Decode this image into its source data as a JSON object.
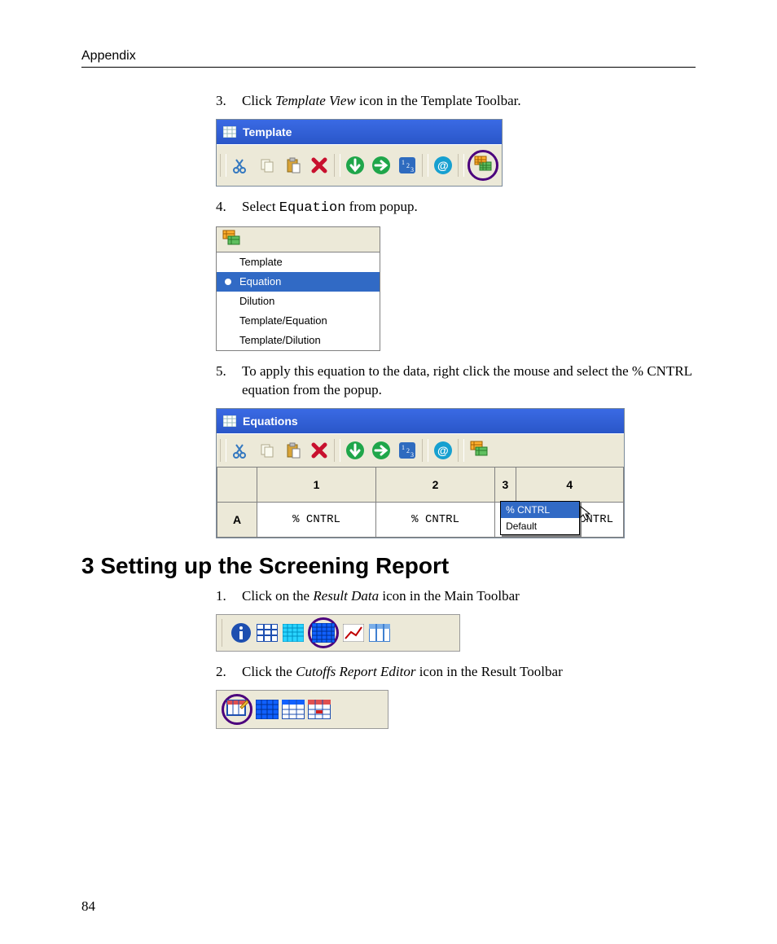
{
  "header": {
    "title": "Appendix"
  },
  "steps_a": {
    "s3": {
      "num": "3.",
      "pre": "Click ",
      "italic": "Template View",
      "post": " icon in the Template Toolbar."
    },
    "s4": {
      "num": "4.",
      "pre": "Select ",
      "mono": "Equation",
      "post": " from popup."
    },
    "s5": {
      "num": "5.",
      "text": "To apply this equation to the data, right click the mouse and select the % CNTRL equation from the popup."
    }
  },
  "template_window": {
    "title": "Template"
  },
  "popup": {
    "items": [
      "Template",
      "Equation",
      "Dilution",
      "Template/Equation",
      "Template/Dilution"
    ],
    "selected_index": 1
  },
  "equations_window": {
    "title": "Equations",
    "cols": [
      "1",
      "2",
      "3",
      "4"
    ],
    "row_label": "A",
    "cells": [
      "% CNTRL",
      "% CNTRL",
      "",
      "CNTRL"
    ],
    "context_menu": {
      "selected": "% CNTRL",
      "other": "Default"
    }
  },
  "section": {
    "num": "3",
    "title": "Setting up the Screening Report"
  },
  "steps_b": {
    "s1": {
      "num": "1.",
      "pre": "Click on the ",
      "italic": "Result Data",
      "post": " icon in the Main Toolbar"
    },
    "s2": {
      "num": "2.",
      "pre": "Click the ",
      "italic": "Cutoffs Report Editor",
      "post": " icon in the Result Toolbar"
    }
  },
  "page_number": "84"
}
